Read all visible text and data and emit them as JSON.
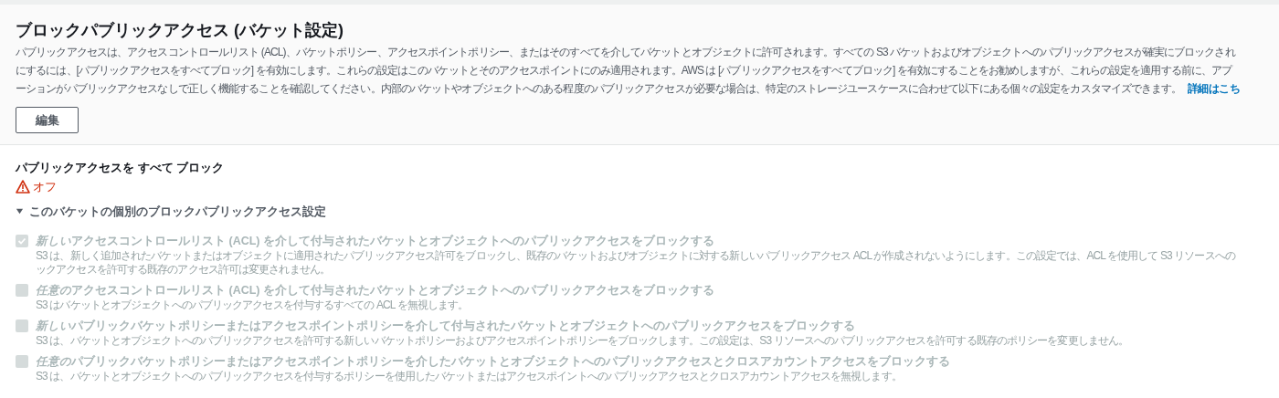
{
  "header": {
    "title": "ブロックパブリックアクセス (バケット設定)",
    "description_lines": [
      "パブリックアクセスは、アクセスコントロールリスト (ACL)、バケットポリシー、アクセスポイントポリシー、またはそのすべてを介してバケットとオブジェクトに許可されます。すべての S3 バケットおよびオブジェクトへのパブリックアクセスが確実にブロックされ",
      "にするには、[パブリックアクセスをすべてブロック] を有効にします。これらの設定はこのバケットとそのアクセスポイントにのみ適用されます。AWS は [パブリックアクセスをすべてブロック] を有効にすることをお勧めしますが、これらの設定を適用する前に、アプ",
      "ーションがパブリックアクセスなしで正しく機能することを確認してください。内部のバケットやオブジェクトへのある程度のパブリックアクセスが必要な場合は、特定のストレージユースケースに合わせて以下にある個々の設定をカスタマイズできます。"
    ],
    "link": "詳細はこち",
    "button": "編集"
  },
  "block_all": {
    "label": "パブリックアクセスを すべて ブロック",
    "status": "オフ",
    "on": false
  },
  "individual": {
    "title": "このバケットの個別のブロックパブリックアクセス設定",
    "expanded": true,
    "items": [
      {
        "title_italic": "新しい",
        "title": "アクセスコントロールリスト (ACL) を介して付与されたバケットとオブジェクトへのパブリックアクセスをブロックする",
        "description_lines": [
          "S3 は、新しく追加されたバケットまたはオブジェクトに適用されたパブリックアクセス許可をブロックし、既存のバケットおよびオブジェクトに対する新しいパブリックアクセス ACL が作成されないようにします。この設定では、ACL を使用して S3 リソースへの",
          "ックアクセスを許可する既存のアクセス許可は変更されません。"
        ],
        "checked": true,
        "disabled": true
      },
      {
        "title_italic": "任意の",
        "title": "アクセスコントロールリスト (ACL) を介して付与されたバケットとオブジェクトへのパブリックアクセスをブロックする",
        "description_lines": [
          "S3 はバケットとオブジェクトへのパブリックアクセスを付与するすべての ACL を無視します。"
        ],
        "checked": false,
        "disabled": true
      },
      {
        "title_italic": "新しい",
        "title": "パブリックバケットポリシーまたはアクセスポイントポリシーを介して付与されたバケットとオブジェクトへのパブリックアクセスをブロックする",
        "description_lines": [
          "S3 は、バケットとオブジェクトへのパブリックアクセスを許可する新しいバケットポリシーおよびアクセスポイントポリシーをブロックします。この設定は、S3 リソースへのパブリックアクセスを許可する既存のポリシーを変更しません。"
        ],
        "checked": false,
        "disabled": true
      },
      {
        "title_italic": "任意の",
        "title": "パブリックバケットポリシーまたはアクセスポイントポリシーを介したバケットとオブジェクトへのパブリックアクセスとクロスアカウントアクセスをブロックする",
        "description_lines": [
          "S3 は、バケットとオブジェクトへのパブリックアクセスを付与するポリシーを使用したバケットまたはアクセスポイントへのパブリックアクセスとクロスアカウントアクセスを無視します。"
        ],
        "checked": false,
        "disabled": true
      }
    ]
  }
}
